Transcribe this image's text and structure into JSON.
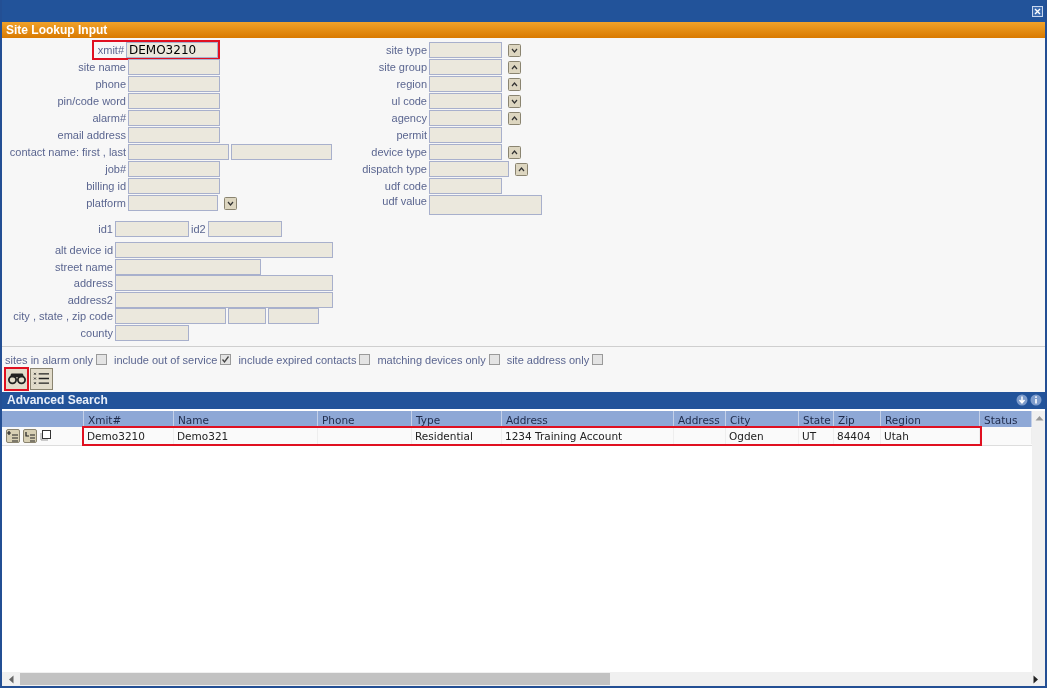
{
  "lookup_panel": {
    "title": "Site Lookup Input",
    "left_fields": [
      {
        "label": "xmit#",
        "value": "DEMO3210",
        "kind": "text",
        "highlighted": true
      },
      {
        "label": "site name",
        "kind": "text",
        "highlighted": false
      },
      {
        "label": "phone",
        "kind": "text",
        "highlighted": false
      },
      {
        "label": "pin/code word",
        "kind": "text",
        "highlighted": false
      },
      {
        "label": "alarm#",
        "kind": "text",
        "highlighted": false
      },
      {
        "label": "email address",
        "kind": "text",
        "highlighted": false
      },
      {
        "label": "contact name: first ,  last",
        "kind": "pair",
        "highlighted": false
      },
      {
        "label": "job#",
        "kind": "text",
        "highlighted": false
      },
      {
        "label": "billing id",
        "kind": "text",
        "highlighted": false
      },
      {
        "label": "platform",
        "kind": "down",
        "highlighted": false
      }
    ],
    "id_fields": [
      {
        "label": "id1"
      },
      {
        "label": "id2"
      }
    ],
    "address_fields": [
      {
        "label": "alt device id",
        "kind": "long"
      },
      {
        "label": "street name",
        "kind": "medium"
      },
      {
        "label": "address",
        "kind": "long"
      },
      {
        "label": "address2",
        "kind": "long"
      },
      {
        "label": "city ,  state ,  zip code",
        "kind": "triple"
      },
      {
        "label": "county",
        "kind": "short"
      }
    ],
    "right_fields": [
      {
        "label": "site type",
        "kind": "down"
      },
      {
        "label": "site group",
        "kind": "up"
      },
      {
        "label": "region",
        "kind": "up"
      },
      {
        "label": "ul code",
        "kind": "down"
      },
      {
        "label": "agency",
        "kind": "up"
      },
      {
        "label": "permit",
        "kind": "text"
      },
      {
        "label": "device type",
        "kind": "up"
      },
      {
        "label": "dispatch type",
        "kind": "wideup"
      },
      {
        "label": "udf code",
        "kind": "text"
      },
      {
        "label": "udf value",
        "kind": "memo"
      }
    ]
  },
  "options": [
    {
      "label": "sites in alarm only",
      "checked": false
    },
    {
      "label": "include out of service",
      "checked": true
    },
    {
      "label": "include expired contacts",
      "checked": false
    },
    {
      "label": "matching devices only",
      "checked": false
    },
    {
      "label": "site address only",
      "checked": false
    }
  ],
  "toolbar": [
    {
      "kind": "search",
      "highlighted": true
    },
    {
      "kind": "list",
      "highlighted": false
    }
  ],
  "results": {
    "title": "Advanced Search",
    "columns": [
      "Xmit#",
      "Name",
      "Phone",
      "Type",
      "Address",
      "Address",
      "City",
      "State",
      "Zip",
      "Region",
      "Status"
    ],
    "rows": [
      {
        "highlighted": true,
        "cells": [
          "Demo3210",
          "Demo321",
          "",
          "Residential",
          "1234 Training Account",
          "",
          "Ogden",
          "UT",
          "84404",
          "Utah",
          ""
        ]
      }
    ]
  }
}
